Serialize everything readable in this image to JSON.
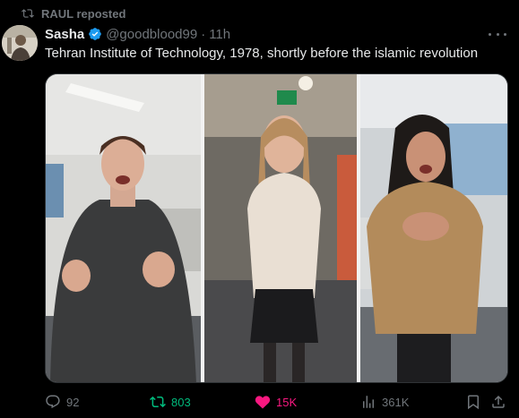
{
  "repost": {
    "text": "RAUL reposted",
    "icon": "repost-icon"
  },
  "author": {
    "name": "Sasha",
    "handle": "@goodblood99",
    "separator": "·",
    "time": "11h",
    "verified_color": "#1d9bf0"
  },
  "tweet": {
    "text": "Tehran Institute of Technology, 1978, shortly before the islamic revolution"
  },
  "actions": {
    "replies": "92",
    "reposts": "803",
    "likes": "15K",
    "views": "361K",
    "colors": {
      "repost": "#00ba7c",
      "like": "#f91880",
      "muted": "#71767b"
    }
  },
  "icons": [
    "repost-icon",
    "verified-badge-icon",
    "more-icon",
    "reply-icon",
    "retweet-icon",
    "heart-icon",
    "views-icon",
    "bookmark-icon",
    "share-icon"
  ]
}
